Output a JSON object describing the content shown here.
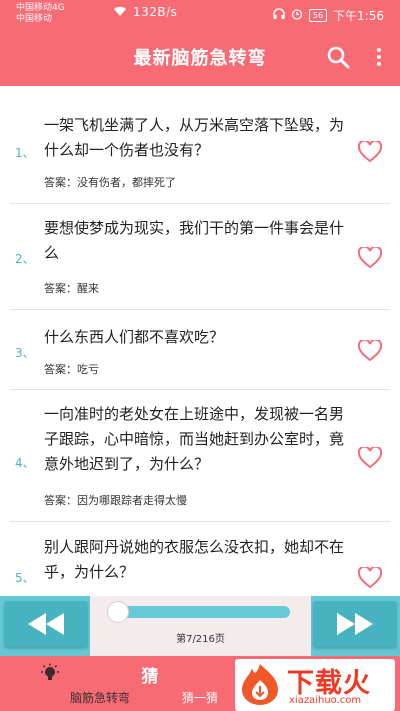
{
  "status_bar": {
    "carrier_line1": "中国移动4G",
    "carrier_line2": "中国移动",
    "net_speed": "132B/s",
    "battery": "56",
    "time": "下午1:56"
  },
  "header": {
    "title": "最新脑筋急转弯",
    "icons": [
      "search-icon",
      "more-vert-icon"
    ]
  },
  "list": {
    "items": [
      {
        "num": "1、",
        "question": "一架飞机坐满了人，从万米高空落下坠毁，为什么却一个伤者也没有？",
        "answer": "答案：没有伤者，都摔死了"
      },
      {
        "num": "2、",
        "question": "要想使梦成为现实，我们干的第一件事会是什么",
        "answer": "答案：醒来"
      },
      {
        "num": "3、",
        "question": "什么东西人们都不喜欢吃？",
        "answer": "答案：吃亏"
      },
      {
        "num": "4、",
        "question": "一向准时的老处女在上班途中，发现被一名男子跟踪，心中暗惊，而当她赶到办公室时，竟意外地迟到了，为什么？",
        "answer": "答案：因为哪跟踪者走得太慢"
      },
      {
        "num": "5、",
        "question": "别人跟阿丹说她的衣服怎么没衣扣，她却不在乎，为什么？",
        "answer": ""
      }
    ]
  },
  "player": {
    "page_info": "第7/216页",
    "progress": 0.03
  },
  "tabs": [
    {
      "label": "脑筋急转弯",
      "icon": "lightbulb-icon"
    },
    {
      "label": "猜一猜",
      "icon": "guess-icon",
      "icon_text": "猜"
    }
  ],
  "watermark": {
    "text": "下载火",
    "sub": "xiazaihuo.com"
  },
  "colors": {
    "primary": "#f86a74",
    "accent": "#64c8d4",
    "accent_dark": "#48b3c0",
    "number": "#4ab6c0"
  }
}
